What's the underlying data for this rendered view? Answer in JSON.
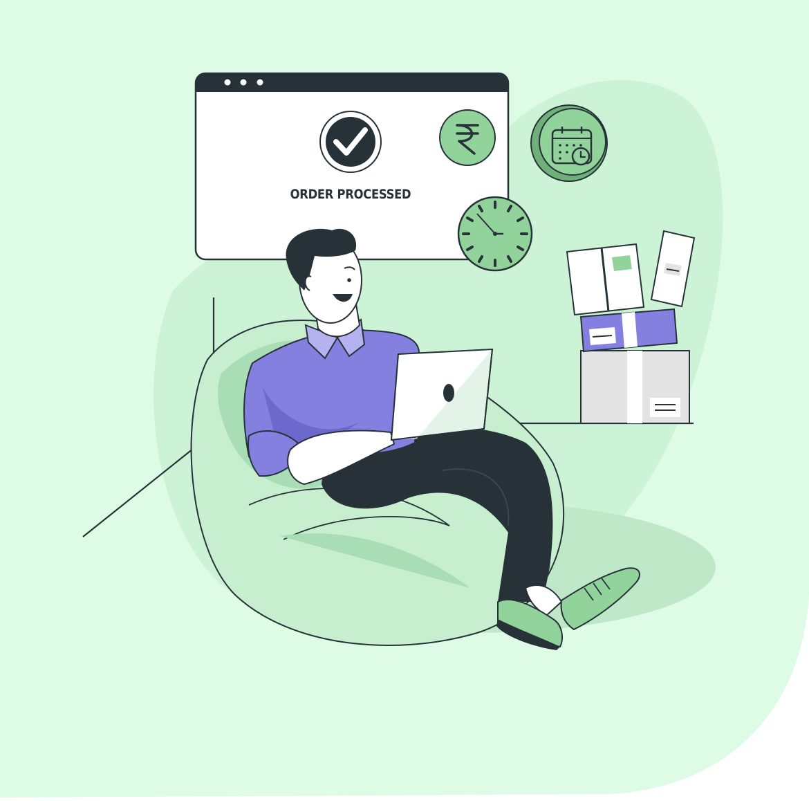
{
  "order_window": {
    "status_text": "ORDER PROCESSED"
  },
  "icons": {
    "window_dots": "window-dots-icon",
    "check": "check-circle-icon",
    "currency": "rupee-icon",
    "calendar": "calendar-clock-icon",
    "clock": "wall-clock-icon"
  },
  "colors": {
    "background": "#ddfbe5",
    "blob": "#d0f5d9",
    "green": "#92d39b",
    "green_dark": "#6fb07a",
    "purple": "#8480e0",
    "purple_dark": "#6d68cc",
    "collar": "#b6b2f0",
    "ink": "#263238",
    "box_gray": "#e3e3e3"
  }
}
